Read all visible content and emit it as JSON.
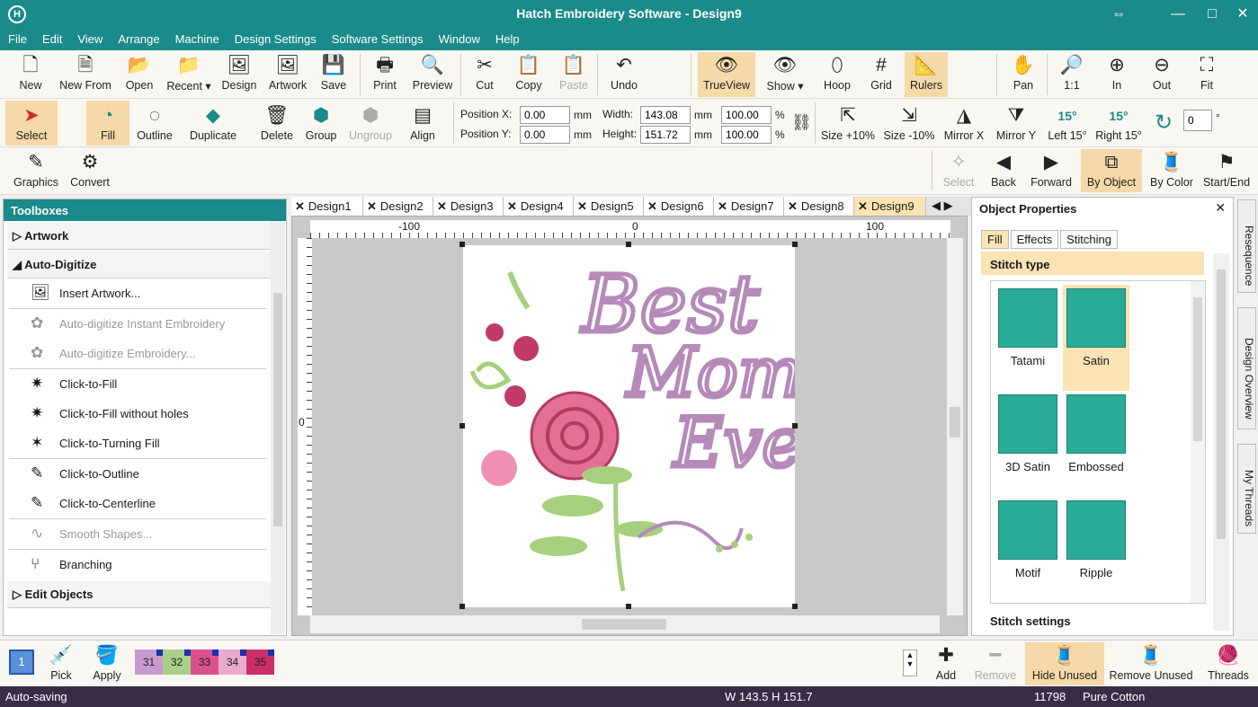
{
  "titlebar": {
    "title": "Hatch Embroidery Software - Design9",
    "logo": "H",
    "restore": "⇔",
    "minimize": "—",
    "maximize": "□",
    "close": "✕"
  },
  "menu": [
    "File",
    "Edit",
    "View",
    "Arrange",
    "Machine",
    "Design Settings",
    "Software Settings",
    "Window",
    "Help"
  ],
  "toolbar1": {
    "new": "New",
    "new_from": "New From",
    "open": "Open",
    "recent": "Recent",
    "design": "Design",
    "artwork": "Artwork",
    "save": "Save",
    "print": "Print",
    "preview": "Preview",
    "cut": "Cut",
    "copy": "Copy",
    "paste": "Paste",
    "undo": "Undo",
    "trueview": "TrueView",
    "show": "Show",
    "hoop": "Hoop",
    "grid": "Grid",
    "rulers": "Rulers",
    "pan": "Pan",
    "one_to_one": "1:1",
    "zoom_in": "In",
    "zoom_out": "Out",
    "fit": "Fit"
  },
  "toolbar2": {
    "select": "Select",
    "fill": "Fill",
    "outline": "Outline",
    "duplicate": "Duplicate",
    "delete": "Delete",
    "group": "Group",
    "ungroup": "Ungroup",
    "align": "Align",
    "position_x_label": "Position X:",
    "position_x": "0.00",
    "position_y_label": "Position Y:",
    "position_y": "0.00",
    "unit_mm": "mm",
    "width_label": "Width:",
    "width": "143.08",
    "height_label": "Height:",
    "height": "151.72",
    "scale_w": "100.00",
    "scale_h": "100.00",
    "pct": "%",
    "size_plus": "Size +10%",
    "size_minus": "Size -10%",
    "mirror_x": "Mirror X",
    "mirror_y": "Mirror Y",
    "left15": "Left 15°",
    "right15": "Right 15°",
    "rotate_badge": "15°",
    "rotate_value": "0",
    "deg": "°"
  },
  "toolbar3": {
    "graphics": "Graphics",
    "convert": "Convert",
    "select": "Select",
    "back": "Back",
    "forward": "Forward",
    "by_object": "By Object",
    "by_color": "By Color",
    "start_end": "Start/End"
  },
  "toolboxes": {
    "title": "Toolboxes",
    "artwork": "Artwork",
    "auto_digitize": "Auto-Digitize",
    "insert_artwork": "Insert Artwork...",
    "instant": "Auto-digitize Instant Embroidery",
    "auto_emb": "Auto-digitize Embroidery...",
    "click_fill": "Click-to-Fill",
    "click_fill_noholes": "Click-to-Fill without holes",
    "click_turning": "Click-to-Turning Fill",
    "click_outline": "Click-to-Outline",
    "click_center": "Click-to-Centerline",
    "smooth": "Smooth Shapes...",
    "branching": "Branching",
    "edit_objects": "Edit Objects"
  },
  "tabs": [
    "Design1",
    "Design2",
    "Design3",
    "Design4",
    "Design5",
    "Design6",
    "Design7",
    "Design8",
    "Design9"
  ],
  "active_tab": "Design9",
  "rulers": {
    "neg100": "-100",
    "zero": "0",
    "pos100": "100",
    "v_zero": "0"
  },
  "design_text": {
    "line1": "Best",
    "line2": "Mom",
    "line3": "Ever"
  },
  "object_properties": {
    "title": "Object Properties",
    "tabs": [
      "Fill",
      "Effects",
      "Stitching"
    ],
    "stitch_type_label": "Stitch type",
    "stitch_types": [
      "Tatami",
      "Satin",
      "3D Satin",
      "Embossed",
      "Motif",
      "Ripple"
    ],
    "selected": "Satin",
    "stitch_settings": "Stitch settings"
  },
  "side_tabs": [
    "Resequence",
    "Design Overview",
    "My Threads"
  ],
  "bottom": {
    "color_index": "1",
    "pick": "Pick",
    "apply": "Apply",
    "chips": [
      {
        "num": "31",
        "color": "#c89ad0"
      },
      {
        "num": "32",
        "color": "#a8d08a"
      },
      {
        "num": "33",
        "color": "#d9508e"
      },
      {
        "num": "34",
        "color": "#e9a9d0"
      },
      {
        "num": "35",
        "color": "#cc2f6a"
      }
    ],
    "add": "Add",
    "remove": "Remove",
    "hide_unused": "Hide Unused",
    "remove_unused": "Remove Unused",
    "threads": "Threads"
  },
  "status": {
    "left": "Auto-saving",
    "center": "W 143.5 H 151.7",
    "stitches": "11798",
    "thread": "Pure Cotton"
  },
  "colors": {
    "teal": "#1a8a8a",
    "active": "#fbe3b3",
    "status_bg": "#3b2c46",
    "stitch_swatch": "#2aab98"
  }
}
